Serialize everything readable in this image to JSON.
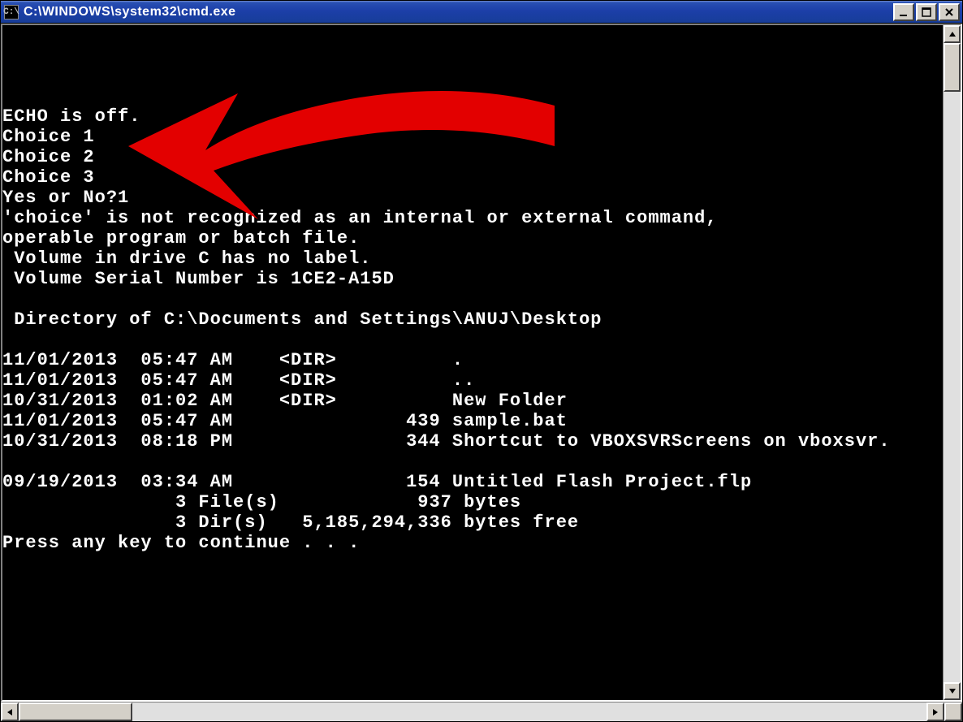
{
  "window": {
    "title": "C:\\WINDOWS\\system32\\cmd.exe",
    "app_icon_text": "C:\\"
  },
  "console": {
    "lines": [
      "ECHO is off.",
      "Choice 1",
      "Choice 2",
      "Choice 3",
      "Yes or No?1",
      "'choice' is not recognized as an internal or external command,",
      "operable program or batch file.",
      " Volume in drive C has no label.",
      " Volume Serial Number is 1CE2-A15D",
      "",
      " Directory of C:\\Documents and Settings\\ANUJ\\Desktop",
      "",
      "11/01/2013  05:47 AM    <DIR>          .",
      "11/01/2013  05:47 AM    <DIR>          ..",
      "10/31/2013  01:02 AM    <DIR>          New Folder",
      "11/01/2013  05:47 AM               439 sample.bat",
      "10/31/2013  08:18 PM               344 Shortcut to VBOXSVRScreens on vboxsvr.",
      "",
      "09/19/2013  03:34 AM               154 Untitled Flash Project.flp",
      "               3 File(s)            937 bytes",
      "               3 Dir(s)   5,185,294,336 bytes free",
      "Press any key to continue . . ."
    ]
  },
  "annotation": {
    "arrow_color": "#E30000"
  }
}
